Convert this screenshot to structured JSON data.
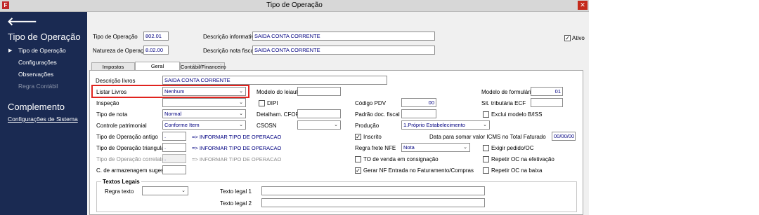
{
  "window": {
    "title": "Tipo de Operação",
    "app_icon_text": "F",
    "close_symbol": "✕"
  },
  "nav": {
    "back_symbol": "🡐",
    "section_title": "Tipo de Operação",
    "items": [
      {
        "label": "Tipo de Operação",
        "active": true
      },
      {
        "label": "Configurações"
      },
      {
        "label": "Observações"
      },
      {
        "label": "Regra Contábil",
        "disabled": true
      }
    ],
    "section2_title": "Complemento",
    "link": "Configurações de Sistema"
  },
  "header": {
    "tipo_label": "Tipo de Operação",
    "tipo_value": "802.01",
    "natureza_label": "Natureza de Operação",
    "natureza_value": "8.02.00",
    "desc_info_label": "Descrição informativa",
    "desc_info_value": "SAIDA CONTA CORRENTE",
    "desc_nf_label": "Descrição nota fiscal",
    "desc_nf_value": "SAIDA CONTA CORRENTE",
    "ativo_label": "Ativo",
    "ativo_checked": true
  },
  "tabs": [
    {
      "label": "Impostos"
    },
    {
      "label": "Geral",
      "active": true
    },
    {
      "label": "Contábil/Financeiro"
    }
  ],
  "geral": {
    "desc_livros_label": "Descrição livros",
    "desc_livros_value": "SAIDA CONTA CORRENTE",
    "listar_livros_label": "Listar Livros",
    "listar_livros_value": "Nenhum",
    "modelo_leiaute_label": "Modelo do leiaute",
    "modelo_leiaute_value": "",
    "modelo_formulario_label": "Modelo de formulário",
    "modelo_formulario_value": "01",
    "inspecao_label": "Inspeção",
    "inspecao_value": "",
    "dipi_label": "DIPI",
    "codigo_pdv_label": "Código PDV",
    "codigo_pdv_value": "00",
    "sit_trib_label": "Sit. tributária ECF",
    "sit_trib_value": "",
    "tipo_nota_label": "Tipo de nota",
    "tipo_nota_value": "Normal",
    "detalham_label": "Detalham. CFOP",
    "detalham_value": "",
    "padrao_label": "Padrão doc. fiscal",
    "padrao_value": "",
    "exclui_label": "Exclui modelo B/ISS",
    "controle_label": "Controle patrimonial",
    "controle_value": "Conforme Item",
    "csosn_label": "CSOSN",
    "csosn_value": "",
    "producao_label": "Produção",
    "producao_value": "1.Próprio Estabelecimento",
    "tipo_antigo_label": "Tipo de Operação antigo",
    "tipo_antigo_value": ".",
    "tipo_antigo_hint": "=> INFORMAR TIPO DE OPERACAO",
    "inscrito_label": "Inscrito",
    "inscrito_checked": true,
    "data_somar_label": "Data para somar valor ICMS no Total Faturado",
    "data_somar_value": "00/00/00",
    "tipo_triangular_label": "Tipo de Operação triangular",
    "tipo_triangular_value": ".",
    "tipo_triangular_hint": "=> INFORMAR TIPO DE OPERACAO",
    "regra_frete_label": "Regra frete NFE",
    "regra_frete_value": "Nota",
    "exigir_label": "Exigir pedido/OC",
    "tipo_correlato_label": "Tipo de Operação correlato",
    "tipo_correlato_value": ".",
    "tipo_correlato_hint": "=> INFORMAR TIPO DE OPERACAO",
    "to_venda_label": "TO de venda em consignação",
    "repetir_ef_label": "Repetir OC na efetivação",
    "armazenagem_label": "C. de armazenagem sugestão",
    "armazenagem_value": "",
    "gerar_nf_label": "Gerar NF Entrada no Faturamento/Compras",
    "gerar_nf_checked": true,
    "repetir_baixa_label": "Repetir OC na baixa",
    "textos_legais": {
      "legend": "Textos Legais",
      "regra_texto_label": "Regra texto",
      "regra_texto_value": "",
      "texto1_label": "Texto legal 1",
      "texto1_value": "",
      "texto2_label": "Texto legal 2",
      "texto2_value": ""
    }
  },
  "colors": {
    "nav_bg": "#1a2a52",
    "field_text": "#000080",
    "highlight": "#e0231e"
  }
}
